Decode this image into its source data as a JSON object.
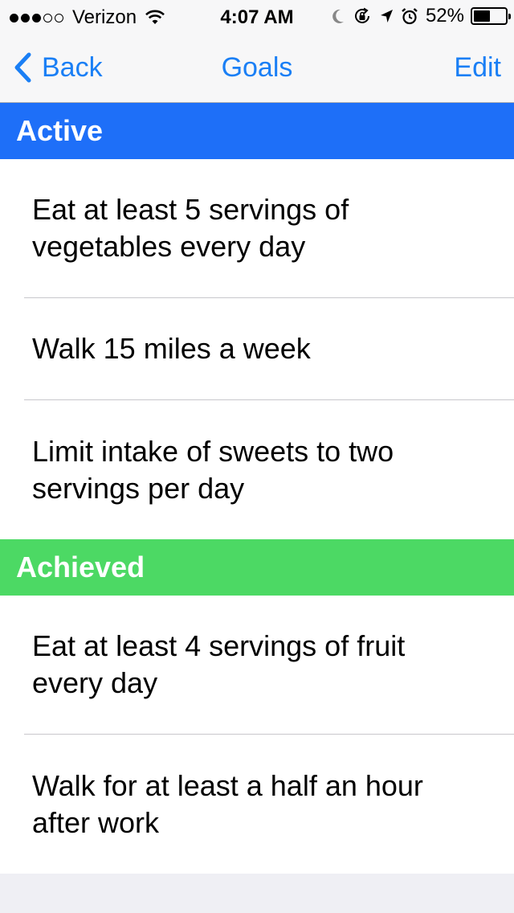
{
  "status_bar": {
    "signal_full": 3,
    "signal_total": 5,
    "carrier": "Verizon",
    "time": "4:07 AM",
    "battery_percent": "52%",
    "battery_level": 0.52,
    "icons": [
      "wifi-icon",
      "moon-icon",
      "rotation-lock-icon",
      "location-arrow-icon",
      "alarm-clock-icon",
      "battery-icon"
    ]
  },
  "nav": {
    "back_label": "Back",
    "title": "Goals",
    "edit_label": "Edit",
    "tint_color": "#1a7ff5"
  },
  "sections": {
    "active": {
      "title": "Active",
      "color": "#1e6ff8",
      "goals": [
        "Eat at least 5 servings of vegetables every day",
        "Walk 15 miles a week",
        "Limit intake of sweets to two servings per day"
      ]
    },
    "achieved": {
      "title": "Achieved",
      "color": "#4cd964",
      "goals": [
        "Eat at least 4 servings of fruit every day",
        "Walk for at least a half an hour after work"
      ]
    }
  }
}
